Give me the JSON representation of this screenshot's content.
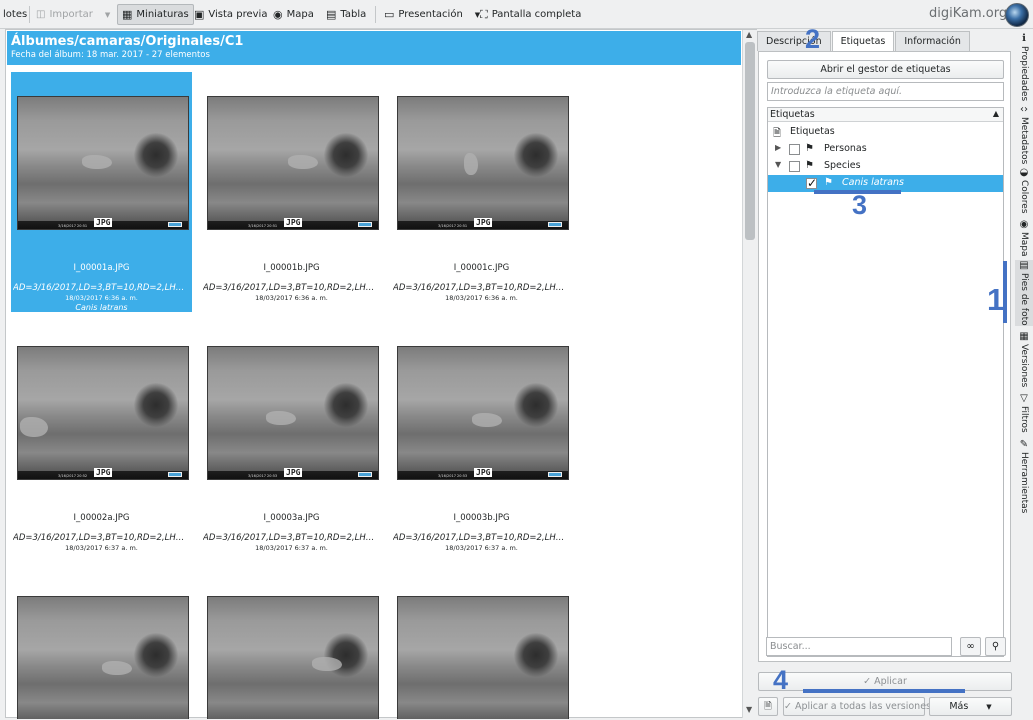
{
  "toolbar": {
    "lotes": "lotes",
    "importar": "Importar",
    "miniaturas": "Miniaturas",
    "vista_previa": "Vista previa",
    "mapa": "Mapa",
    "tabla": "Tabla",
    "presentacion": "Presentación",
    "pantalla_completa": "Pantalla completa",
    "brand": "digiKam.org"
  },
  "album": {
    "title": "Álbumes/camaras/Originales/C1",
    "subtitle": "Fecha del álbum: 18 mar. 2017 - 27 elementos"
  },
  "items": [
    {
      "name": "I_00001a.JPG",
      "meta": "AD=3/16/2017,LD=3,BT=10,RD=2,LH=0,...",
      "date": "18/03/2017 6:36 a. m.",
      "tag": "Canis latrans",
      "badge": "JPG",
      "stamp": "3/16/2017    20:51"
    },
    {
      "name": "I_00001b.JPG",
      "meta": "AD=3/16/2017,LD=3,BT=10,RD=2,LH=0,...",
      "date": "18/03/2017 6:36 a. m.",
      "badge": "JPG",
      "stamp": "3/16/2017    20:51"
    },
    {
      "name": "I_00001c.JPG",
      "meta": "AD=3/16/2017,LD=3,BT=10,RD=2,LH=0,...",
      "date": "18/03/2017 6:36 a. m.",
      "badge": "JPG",
      "stamp": "3/16/2017    20:51"
    },
    {
      "name": "I_00002a.JPG",
      "meta": "AD=3/16/2017,LD=3,BT=10,RD=2,LH=0,...",
      "date": "18/03/2017 6:37 a. m.",
      "badge": "JPG",
      "stamp": "3/16/2017    20:52"
    },
    {
      "name": "I_00003a.JPG",
      "meta": "AD=3/16/2017,LD=3,BT=10,RD=2,LH=0,...",
      "date": "18/03/2017 6:37 a. m.",
      "badge": "JPG",
      "stamp": "3/16/2017    20:53"
    },
    {
      "name": "I_00003b.JPG",
      "meta": "AD=3/16/2017,LD=3,BT=10,RD=2,LH=0,...",
      "date": "18/03/2017 6:37 a. m.",
      "badge": "JPG",
      "stamp": "3/16/2017    20:53"
    },
    {
      "badge": "",
      "stamp": ""
    },
    {
      "badge": "",
      "stamp": ""
    },
    {
      "badge": "",
      "stamp": ""
    }
  ],
  "right_panel": {
    "tabs": [
      "Descripción",
      "Etiquetas",
      "Información"
    ],
    "open_manager": "Abrir el gestor de etiquetas",
    "tag_input_placeholder": "Introduzca la etiqueta aquí.",
    "tree_header": "Etiquetas",
    "tree": [
      "Etiquetas",
      "Personas",
      "Species",
      "Canis latrans"
    ],
    "search_placeholder": "Buscar...",
    "apply": "Aplicar",
    "apply_all": "Aplicar a todas las versiones",
    "more": "Más"
  },
  "side_tabs": [
    "Propiedades",
    "Metadatos",
    "Colores",
    "Mapa",
    "Pies de foto",
    "Versiones",
    "Filtros",
    "Herramientas"
  ],
  "annotations": [
    "1",
    "2",
    "3",
    "4"
  ],
  "colors": {
    "selection": "#3daee9",
    "annotation": "#4472c4"
  }
}
